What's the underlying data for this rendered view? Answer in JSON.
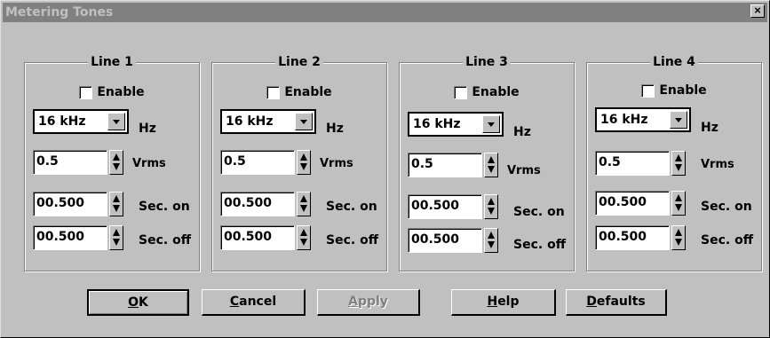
{
  "window": {
    "title": "Metering Tones",
    "close_glyph": "×"
  },
  "lines": [
    {
      "title": "Line 1",
      "enable_label": "Enable",
      "freq": "16 kHz",
      "freq_unit": "Hz",
      "voltage": "0.5",
      "voltage_unit": "Vrms",
      "sec_on": "00.500",
      "sec_on_label": "Sec. on",
      "sec_off": "00.500",
      "sec_off_label": "Sec. off",
      "enabled": false
    },
    {
      "title": "Line 2",
      "enable_label": "Enable",
      "freq": "16 kHz",
      "freq_unit": "Hz",
      "voltage": "0.5",
      "voltage_unit": "Vrms",
      "sec_on": "00.500",
      "sec_on_label": "Sec. on",
      "sec_off": "00.500",
      "sec_off_label": "Sec. off",
      "enabled": false
    },
    {
      "title": "Line 3",
      "enable_label": "Enable",
      "freq": "16 kHz",
      "freq_unit": "Hz",
      "voltage": "0.5",
      "voltage_unit": "Vrms",
      "sec_on": "00.500",
      "sec_on_label": "Sec. on",
      "sec_off": "00.500",
      "sec_off_label": "Sec. off",
      "enabled": false
    },
    {
      "title": "Line 4",
      "enable_label": "Enable",
      "freq": "16 kHz",
      "freq_unit": "Hz",
      "voltage": "0.5",
      "voltage_unit": "Vrms",
      "sec_on": "00.500",
      "sec_on_label": "Sec. on",
      "sec_off": "00.500",
      "sec_off_label": "Sec. off",
      "enabled": false
    }
  ],
  "buttons": {
    "ok": {
      "label": "OK",
      "mnemonic": "O"
    },
    "cancel": {
      "label": "Cancel",
      "mnemonic": "C"
    },
    "apply": {
      "label": "Apply",
      "mnemonic": "A",
      "disabled": true
    },
    "help": {
      "label": "Help",
      "mnemonic": "H"
    },
    "defaults": {
      "label": "Defaults",
      "mnemonic": "D"
    }
  },
  "colors": {
    "face": "#c0c0c0",
    "title_bar": "#808080",
    "title_text": "#c0c0c0",
    "disabled_text": "#808080"
  }
}
